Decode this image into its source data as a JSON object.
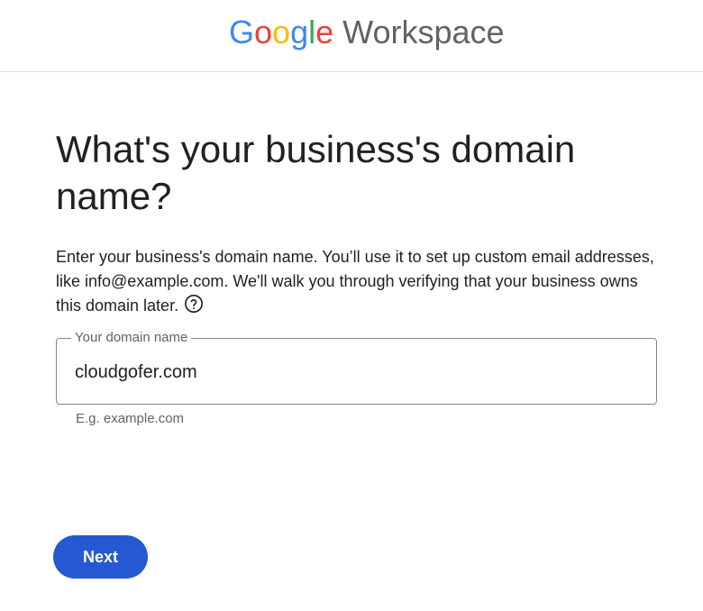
{
  "header": {
    "logo_parts": [
      "G",
      "o",
      "o",
      "g",
      "l",
      "e"
    ],
    "product": "Workspace"
  },
  "main": {
    "title": "What's your business's domain name?",
    "description": "Enter your business's domain name. You’ll use it to set up custom email addresses, like info@example.com. We'll walk you through verifying that your business owns this domain later.",
    "help_icon": "help-circle-icon",
    "domain_field": {
      "label": "Your domain name",
      "value": "cloudgofer.com",
      "hint": "E.g. example.com"
    },
    "next_label": "Next"
  },
  "colors": {
    "button": "#2459d1",
    "border": "#80868b",
    "google_blue": "#4285F4",
    "google_red": "#EA4335",
    "google_yellow": "#FBBC05",
    "google_green": "#34A853"
  }
}
